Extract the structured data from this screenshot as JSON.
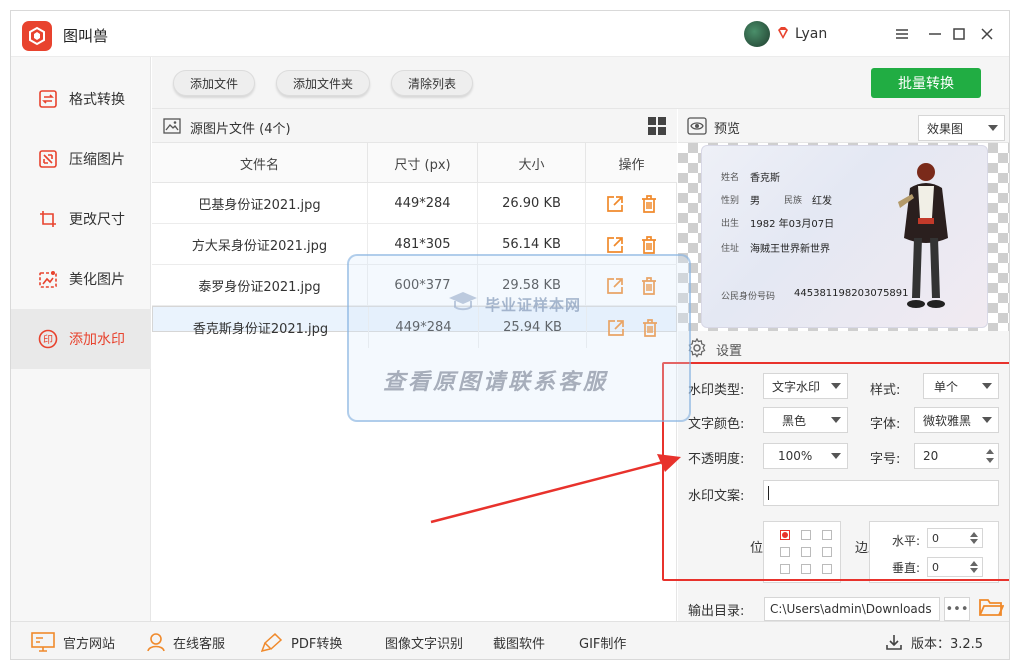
{
  "app": {
    "name": "图叫兽",
    "user": "Lyan"
  },
  "toolbar": {
    "add_file": "添加文件",
    "add_folder": "添加文件夹",
    "clear_list": "清除列表",
    "batch_convert": "批量转换"
  },
  "sidebar": {
    "items": [
      {
        "label": "格式转换",
        "icon": "format-convert-icon"
      },
      {
        "label": "压缩图片",
        "icon": "compress-icon"
      },
      {
        "label": "更改尺寸",
        "icon": "resize-icon"
      },
      {
        "label": "美化图片",
        "icon": "beautify-icon"
      },
      {
        "label": "添加水印",
        "icon": "watermark-icon",
        "active": true
      }
    ]
  },
  "files": {
    "header": "源图片文件 (4个)",
    "columns": [
      "文件名",
      "尺寸 (px)",
      "大小",
      "操作"
    ],
    "rows": [
      {
        "name": "巴基身份证2021.jpg",
        "size": "449*284",
        "bytes": "26.90 KB"
      },
      {
        "name": "方大呆身份证2021.jpg",
        "size": "481*305",
        "bytes": "56.14 KB"
      },
      {
        "name": "泰罗身份证2021.jpg",
        "size": "600*377",
        "bytes": "29.58 KB"
      },
      {
        "name": "香克斯身份证2021.jpg",
        "size": "449*284",
        "bytes": "25.94 KB"
      }
    ]
  },
  "preview": {
    "title": "预览",
    "mode": "效果图",
    "card": {
      "name_label": "姓名",
      "name": "香克斯",
      "sex_label": "性别",
      "sex": "男",
      "nation_label": "民族",
      "nation": "红发",
      "birth_label": "出生",
      "birth": "1982  年03月07日",
      "addr_label": "住址",
      "addr": "海贼王世界新世界",
      "id_label": "公民身份号码",
      "id": "445381198203075891"
    }
  },
  "settings": {
    "title": "设置",
    "wm_type_label": "水印类型:",
    "wm_type": "文字水印",
    "style_label": "样式:",
    "style": "单个",
    "color_label": "文字颜色:",
    "color": "黑色",
    "font_label": "字体:",
    "font": "微软雅黑",
    "opacity_label": "不透明度:",
    "opacity": "100%",
    "fontsize_label": "字号:",
    "fontsize": "20",
    "text_label": "水印文案:",
    "text": "",
    "position_label": "位置",
    "margin_label": "边距",
    "h_label": "水平:",
    "h": "0",
    "v_label": "垂直:",
    "v": "0",
    "output_label": "输出目录:",
    "output": "C:\\Users\\admin\\Downloads"
  },
  "footer": {
    "site": "官方网站",
    "service": "在线客服",
    "pdf": "PDF转换",
    "ocr": "图像文字识别",
    "screenshot": "截图软件",
    "gif": "GIF制作",
    "version": "版本：3.2.5"
  },
  "overlay": {
    "brand": "毕业证样本网",
    "notice": "查看原图请联系客服"
  },
  "colors": {
    "accent": "#e8432e",
    "green": "#21ad43",
    "red_box": "#e8322c"
  }
}
